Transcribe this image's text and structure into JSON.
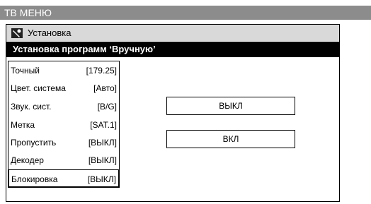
{
  "top_bar": {
    "title": "ТВ МЕНЮ"
  },
  "panel": {
    "title": "Установка",
    "header": "Установка программ ‘Вручную’",
    "menu": [
      {
        "label": "Точный",
        "value": "[179.25]"
      },
      {
        "label": "Цвет. система",
        "value": "[Авто]"
      },
      {
        "label": "Звук. сист.",
        "value": "[B/G]"
      },
      {
        "label": "Метка",
        "value": "[SAT.1]"
      },
      {
        "label": "Пропустить",
        "value": "[ВЫКЛ]"
      },
      {
        "label": "Декодер",
        "value": "[ВЫКЛ]"
      },
      {
        "label": "Блокировка",
        "value": "[ВЫКЛ]"
      }
    ],
    "options": {
      "off": "ВЫКЛ",
      "on": "ВКЛ"
    }
  }
}
